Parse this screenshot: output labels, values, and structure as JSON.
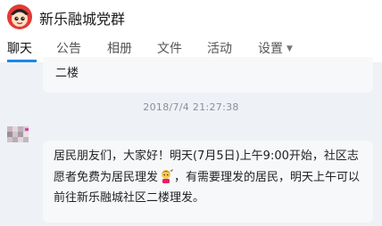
{
  "header": {
    "group_name": "新乐融城党群"
  },
  "tabs": [
    {
      "label": "聊天",
      "active": true
    },
    {
      "label": "公告",
      "active": false
    },
    {
      "label": "相册",
      "active": false
    },
    {
      "label": "文件",
      "active": false
    },
    {
      "label": "活动",
      "active": false
    },
    {
      "label": "设置",
      "active": false,
      "has_dropdown": true
    }
  ],
  "chat": {
    "previous_message_tail": "二楼",
    "timestamp": "2018/7/4 21:27:38",
    "message": {
      "part1": "居民朋友们，大家好！明天(7月5日)上午9:00开始，社区志愿者免费为居民理发",
      "emoji": "haircut-emoji",
      "part2": "，有需要理发的居民，明天上午可以前往新乐融城社区二楼理发。"
    }
  },
  "colors": {
    "accent": "#1e88e5",
    "chat_background": "#eef1f5",
    "bubble": "#f7f8fa",
    "timestamp": "#8a8f99"
  }
}
